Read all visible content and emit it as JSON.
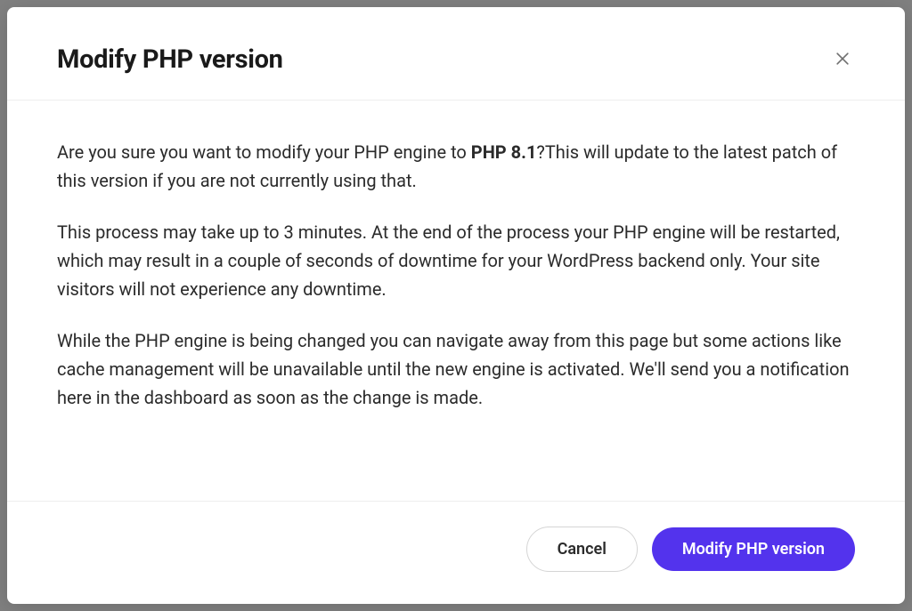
{
  "modal": {
    "title": "Modify PHP version",
    "paragraph1_prefix": "Are you sure you want to modify your PHP engine to ",
    "paragraph1_version": "PHP 8.1",
    "paragraph1_suffix": "?This will update to the latest patch of this version if you are not currently using that.",
    "paragraph2": "This process may take up to 3 minutes. At the end of the process your PHP engine will be restarted, which may result in a couple of seconds of downtime for your WordPress backend only. Your site visitors will not experience any downtime.",
    "paragraph3": "While the PHP engine is being changed you can navigate away from this page but some actions like cache management will be unavailable until the new engine is activated. We'll send you a notification here in the dashboard as soon as the change is made.",
    "cancel_label": "Cancel",
    "confirm_label": "Modify PHP version"
  }
}
